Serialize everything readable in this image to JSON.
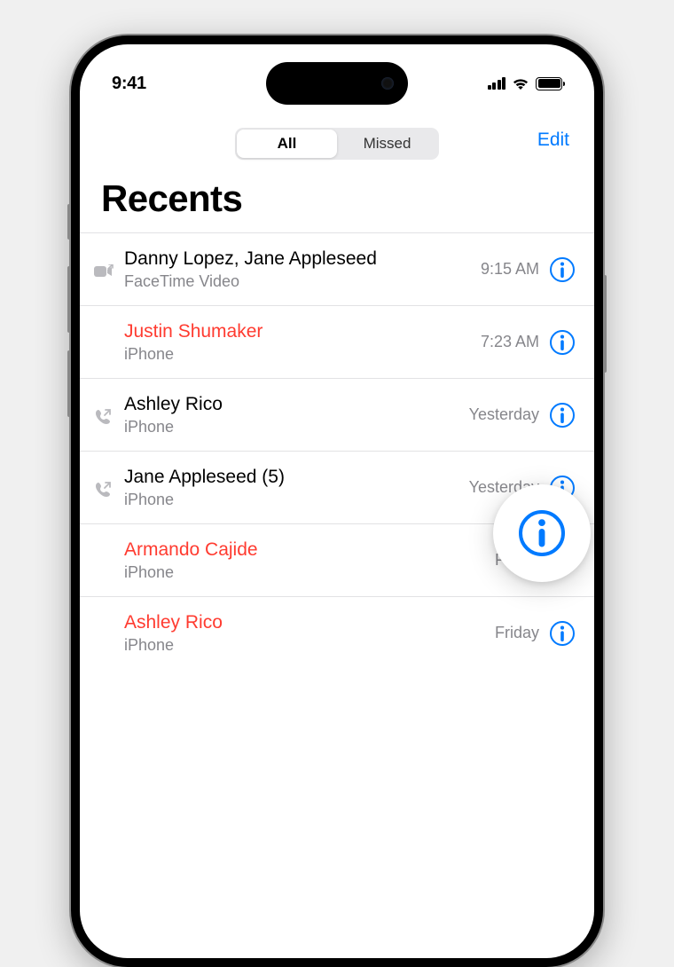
{
  "status": {
    "time": "9:41"
  },
  "header": {
    "segment": {
      "all": "All",
      "missed": "Missed"
    },
    "edit": "Edit"
  },
  "title": "Recents",
  "calls": [
    {
      "name": "Danny Lopez, Jane Appleseed",
      "sub": "FaceTime Video",
      "time": "9:15 AM",
      "missed": false,
      "icon": "video-out"
    },
    {
      "name": "Justin Shumaker",
      "sub": "iPhone",
      "time": "7:23 AM",
      "missed": true,
      "icon": null
    },
    {
      "name": "Ashley Rico",
      "sub": "iPhone",
      "time": "Yesterday",
      "missed": false,
      "icon": "phone-out"
    },
    {
      "name": "Jane Appleseed (5)",
      "sub": "iPhone",
      "time": "Yesterday",
      "missed": false,
      "icon": "phone-out"
    },
    {
      "name": "Armando Cajide",
      "sub": "iPhone",
      "time": "Friday",
      "missed": true,
      "icon": null
    },
    {
      "name": "Ashley Rico",
      "sub": "iPhone",
      "time": "Friday",
      "missed": true,
      "icon": null
    }
  ]
}
